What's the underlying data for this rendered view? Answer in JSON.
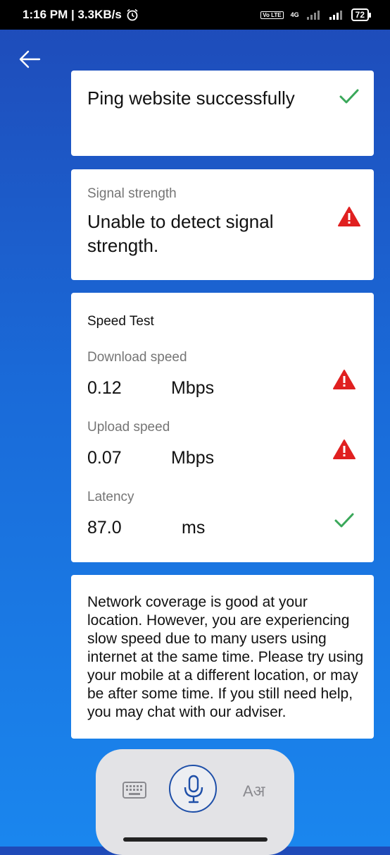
{
  "status_bar": {
    "time_speed": "1:16 PM | 3.3KB/s",
    "volte": "Vo LTE",
    "network": "4G",
    "battery": "72"
  },
  "ping": {
    "text": "Ping website successfully"
  },
  "signal": {
    "label": "Signal strength",
    "text": "Unable to detect signal strength."
  },
  "speed_test": {
    "title": "Speed Test",
    "download_label": "Download speed",
    "download_value": "0.12",
    "download_unit": "Mbps",
    "upload_label": "Upload speed",
    "upload_value": "0.07",
    "upload_unit": "Mbps",
    "latency_label": "Latency",
    "latency_value": "87.0",
    "latency_unit": "ms"
  },
  "message": {
    "text": "Network coverage is good at your location. However, you are experiencing slow speed due to many users using internet at the same time. Please try using your mobile at a different location, or may be after some time. If you still need help, you may chat with our adviser."
  },
  "input_bar": {
    "language_glyph": "Aअ"
  },
  "icons": {
    "success": "check-icon",
    "warning": "warning-icon"
  },
  "colors": {
    "success": "#3aa85a",
    "warning": "#e02020",
    "accent": "#1e4fa8"
  }
}
